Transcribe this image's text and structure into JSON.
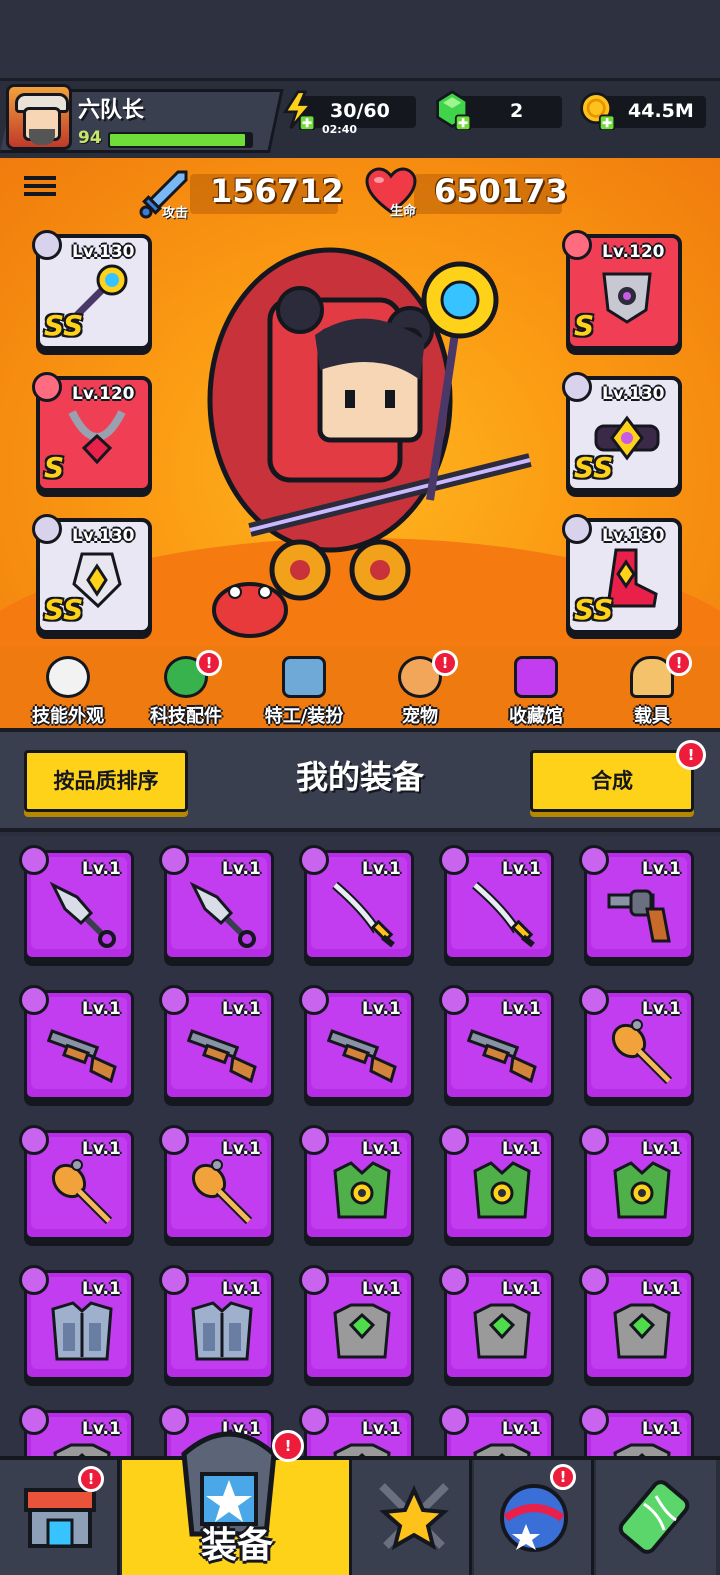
{
  "player": {
    "name": "六队长",
    "level": "94",
    "xp_fraction": 0.96
  },
  "resources": {
    "energy": "30/60",
    "energy_timer": "02:40",
    "gems": "2",
    "gold": "44.5M"
  },
  "stats": {
    "attack_label": "攻击",
    "attack_value": "156712",
    "hp_label": "生命",
    "hp_value": "650173"
  },
  "slots": [
    {
      "level": "Lv.130",
      "grade": "SS",
      "side": "left",
      "item": "staff"
    },
    {
      "level": "Lv.120",
      "grade": "S",
      "side": "left",
      "item": "necklace"
    },
    {
      "level": "Lv.130",
      "grade": "SS",
      "side": "left",
      "item": "gauntlet"
    },
    {
      "level": "Lv.120",
      "grade": "S",
      "side": "right",
      "item": "armor"
    },
    {
      "level": "Lv.130",
      "grade": "SS",
      "side": "right",
      "item": "belt"
    },
    {
      "level": "Lv.130",
      "grade": "SS",
      "side": "right",
      "item": "boots"
    }
  ],
  "functions": [
    {
      "label": "技能外观",
      "alert": false
    },
    {
      "label": "科技配件",
      "alert": true
    },
    {
      "label": "特工/装扮",
      "alert": false
    },
    {
      "label": "宠物",
      "alert": true
    },
    {
      "label": "收藏馆",
      "alert": false
    },
    {
      "label": "载具",
      "alert": true
    }
  ],
  "equipment": {
    "sort_button": "按品质排序",
    "title": "我的装备",
    "merge_button": "合成",
    "alert": "!",
    "items": [
      {
        "level": "Lv.1",
        "item": "kunai"
      },
      {
        "level": "Lv.1",
        "item": "kunai"
      },
      {
        "level": "Lv.1",
        "item": "katana"
      },
      {
        "level": "Lv.1",
        "item": "katana"
      },
      {
        "level": "Lv.1",
        "item": "revolver"
      },
      {
        "level": "Lv.1",
        "item": "shotgun"
      },
      {
        "level": "Lv.1",
        "item": "shotgun"
      },
      {
        "level": "Lv.1",
        "item": "shotgun"
      },
      {
        "level": "Lv.1",
        "item": "shotgun"
      },
      {
        "level": "Lv.1",
        "item": "bat"
      },
      {
        "level": "Lv.1",
        "item": "bat"
      },
      {
        "level": "Lv.1",
        "item": "bat"
      },
      {
        "level": "Lv.1",
        "item": "green-armor"
      },
      {
        "level": "Lv.1",
        "item": "green-armor"
      },
      {
        "level": "Lv.1",
        "item": "green-armor"
      },
      {
        "level": "Lv.1",
        "item": "steel-armor"
      },
      {
        "level": "Lv.1",
        "item": "steel-armor"
      },
      {
        "level": "Lv.1",
        "item": "stone-armor"
      },
      {
        "level": "Lv.1",
        "item": "stone-armor"
      },
      {
        "level": "Lv.1",
        "item": "stone-armor"
      },
      {
        "level": "Lv.1",
        "item": "stone-armor"
      },
      {
        "level": "Lv.1",
        "item": "stone-armor"
      },
      {
        "level": "Lv.1",
        "item": "stone-armor"
      },
      {
        "level": "Lv.1",
        "item": "stone-armor"
      },
      {
        "level": "Lv.1",
        "item": "stone-armor"
      }
    ]
  },
  "bottom_nav": {
    "active_label": "装备",
    "items": [
      "shop-icon",
      "equipment-icon",
      "battle-icon",
      "ball-icon",
      "gene-icon"
    ]
  },
  "colors": {
    "accent_yellow": "#ffd21a",
    "orange_bg": "#fb9a13",
    "purple_item": "#c23cf0",
    "alert_red": "#ec1c3a"
  }
}
